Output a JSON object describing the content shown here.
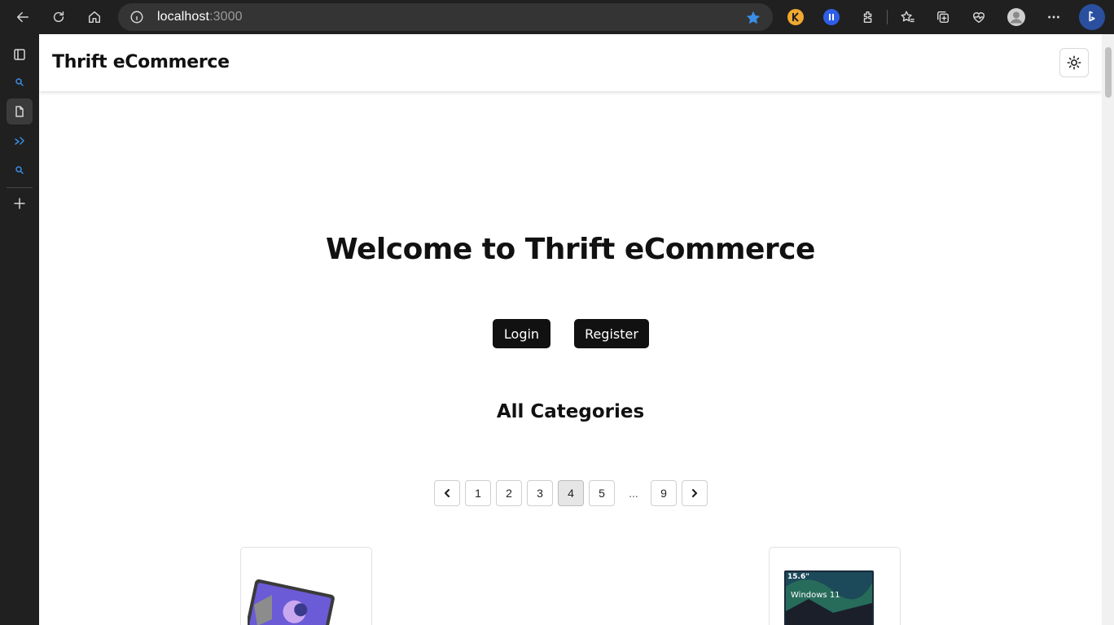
{
  "browser": {
    "url_host": "localhost",
    "url_port": ":3000",
    "colors": {
      "chrome_bg": "#202020",
      "address_bg": "#343434",
      "star": "#3a8ee6"
    }
  },
  "app": {
    "title": "Thrift eCommerce"
  },
  "hero": {
    "heading": "Welcome to Thrift eCommerce",
    "login_label": "Login",
    "register_label": "Register"
  },
  "categories": {
    "heading": "All Categories"
  },
  "pagination": {
    "pages": [
      "1",
      "2",
      "3",
      "4",
      "5"
    ],
    "ellipsis": "...",
    "last_page": "9",
    "current": "4"
  },
  "products": {
    "laptop_screen_size": "15.6\"",
    "laptop_os": "Windows 11"
  }
}
